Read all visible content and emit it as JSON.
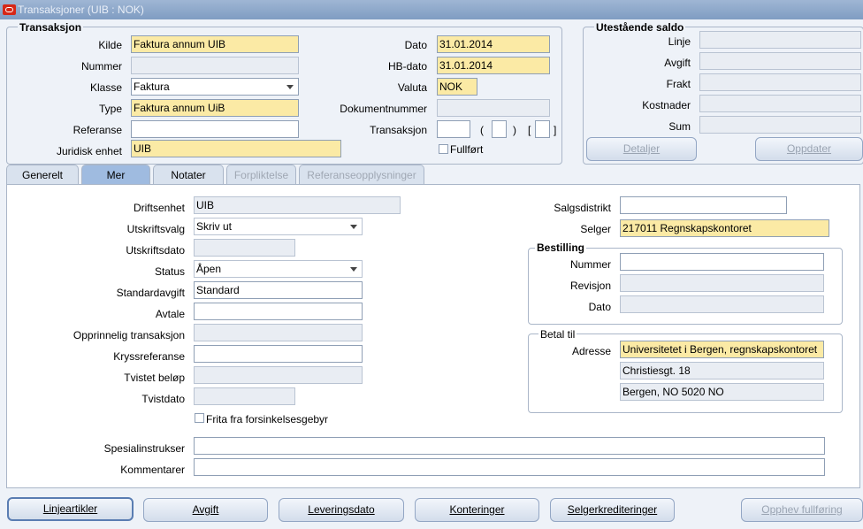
{
  "window": {
    "title": "Transaksjoner (UIB : NOK)"
  },
  "transaksjon": {
    "group_title": "Transaksjon",
    "kilde_label": "Kilde",
    "kilde_value": "Faktura annum UIB",
    "nummer_label": "Nummer",
    "nummer_value": "",
    "klasse_label": "Klasse",
    "klasse_value": "Faktura",
    "type_label": "Type",
    "type_value": "Faktura annum UiB",
    "referanse_label": "Referanse",
    "referanse_value": "",
    "juridisk_label": "Juridisk enhet",
    "juridisk_value": "UIB",
    "dato_label": "Dato",
    "dato_value": "31.01.2014",
    "hbdato_label": "HB-dato",
    "hbdato_value": "31.01.2014",
    "valuta_label": "Valuta",
    "valuta_value": "NOK",
    "dokumentnummer_label": "Dokumentnummer",
    "dokumentnummer_value": "",
    "transaksjon_label": "Transaksjon",
    "fullfort_label": "Fullført"
  },
  "saldo": {
    "group_title": "Utestående saldo",
    "linje_label": "Linje",
    "avgift_label": "Avgift",
    "frakt_label": "Frakt",
    "kostnader_label": "Kostnader",
    "sum_label": "Sum",
    "detaljer_button": "Detaljer",
    "oppdater_button": "Oppdater"
  },
  "tabs": [
    {
      "label": "Generelt"
    },
    {
      "label": "Mer"
    },
    {
      "label": "Notater"
    },
    {
      "label": "Forpliktelse"
    },
    {
      "label": "Referanseopplysninger"
    }
  ],
  "mer": {
    "driftsenhet_label": "Driftsenhet",
    "driftsenhet_value": "UIB",
    "utskriftsvalg_label": "Utskriftsvalg",
    "utskriftsvalg_value": "Skriv ut",
    "utskriftsdato_label": "Utskriftsdato",
    "utskriftsdato_value": "",
    "status_label": "Status",
    "status_value": "Åpen",
    "standardavgift_label": "Standardavgift",
    "standardavgift_value": "Standard",
    "avtale_label": "Avtale",
    "avtale_value": "",
    "opprinnelig_label": "Opprinnelig transaksjon",
    "opprinnelig_value": "",
    "kryssreferanse_label": "Kryssreferanse",
    "kryssreferanse_value": "",
    "tvistet_label": "Tvistet beløp",
    "tvistet_value": "",
    "tvistdato_label": "Tvistdato",
    "tvistdato_value": "",
    "frita_label": "Frita fra forsinkelsesgebyr",
    "salgsdistrikt_label": "Salgsdistrikt",
    "salgsdistrikt_value": "",
    "selger_label": "Selger",
    "selger_value": "217011 Regnskapskontoret",
    "bestilling_title": "Bestilling",
    "nummer_label": "Nummer",
    "nummer_value": "",
    "revisjon_label": "Revisjon",
    "revisjon_value": "",
    "dato_label": "Dato",
    "dato_value": "",
    "betal_title": "Betal til",
    "adresse_label": "Adresse",
    "adresse_line1": "Universitetet i Bergen, regnskapskontoret",
    "adresse_line2": "Christiesgt. 18",
    "adresse_line3": "Bergen, NO 5020 NO",
    "spesial_label": "Spesialinstrukser",
    "spesial_value": "",
    "kommentarer_label": "Kommentarer",
    "kommentarer_value": ""
  },
  "buttons": {
    "linjeartikler": "Linjeartikler",
    "avgift": "Avgift",
    "leveringsdato": "Leveringsdato",
    "konteringer": "Konteringer",
    "selgerkrediteringer": "Selgerkrediteringer",
    "opphev": "Opphev fullføring"
  },
  "colors": {
    "required_field": "#fbeaa5",
    "titlebar": "#8aa6cb",
    "active_tab": "#9fbbe0"
  }
}
